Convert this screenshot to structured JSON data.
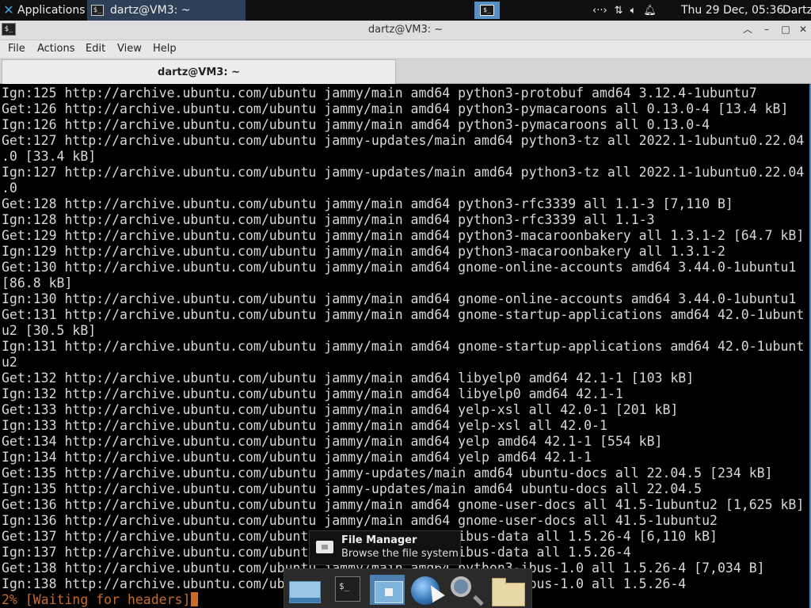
{
  "panel": {
    "applications_label": "Applications",
    "applications_icon": "xfce-mouse-icon",
    "task_terminal_label": "dartz@VM3: ~",
    "clock": "Thu 29 Dec, 05:36",
    "user": "Dartz",
    "tray_icons": [
      "network-icon",
      "transfer-icon",
      "volume-icon",
      "notification-bell-icon"
    ]
  },
  "window": {
    "title": "dartz@VM3: ~",
    "menu": [
      "File",
      "Actions",
      "Edit",
      "View",
      "Help"
    ],
    "tab_label": "dartz@VM3: ~"
  },
  "terminal": {
    "lines": [
      "Ign:125 http://archive.ubuntu.com/ubuntu jammy/main amd64 python3-protobuf amd64 3.12.4-1ubuntu7",
      "Get:126 http://archive.ubuntu.com/ubuntu jammy/main amd64 python3-pymacaroons all 0.13.0-4 [13.4 kB]",
      "Ign:126 http://archive.ubuntu.com/ubuntu jammy/main amd64 python3-pymacaroons all 0.13.0-4",
      "Get:127 http://archive.ubuntu.com/ubuntu jammy-updates/main amd64 python3-tz all 2022.1-1ubuntu0.22.04",
      ".0 [33.4 kB]",
      "Ign:127 http://archive.ubuntu.com/ubuntu jammy-updates/main amd64 python3-tz all 2022.1-1ubuntu0.22.04",
      ".0",
      "Get:128 http://archive.ubuntu.com/ubuntu jammy/main amd64 python3-rfc3339 all 1.1-3 [7,110 B]",
      "Ign:128 http://archive.ubuntu.com/ubuntu jammy/main amd64 python3-rfc3339 all 1.1-3",
      "Get:129 http://archive.ubuntu.com/ubuntu jammy/main amd64 python3-macaroonbakery all 1.3.1-2 [64.7 kB]",
      "Ign:129 http://archive.ubuntu.com/ubuntu jammy/main amd64 python3-macaroonbakery all 1.3.1-2",
      "Get:130 http://archive.ubuntu.com/ubuntu jammy/main amd64 gnome-online-accounts amd64 3.44.0-1ubuntu1",
      "[86.8 kB]",
      "Ign:130 http://archive.ubuntu.com/ubuntu jammy/main amd64 gnome-online-accounts amd64 3.44.0-1ubuntu1",
      "Get:131 http://archive.ubuntu.com/ubuntu jammy/main amd64 gnome-startup-applications amd64 42.0-1ubunt",
      "u2 [30.5 kB]",
      "Ign:131 http://archive.ubuntu.com/ubuntu jammy/main amd64 gnome-startup-applications amd64 42.0-1ubunt",
      "u2",
      "Get:132 http://archive.ubuntu.com/ubuntu jammy/main amd64 libyelp0 amd64 42.1-1 [103 kB]",
      "Ign:132 http://archive.ubuntu.com/ubuntu jammy/main amd64 libyelp0 amd64 42.1-1",
      "Get:133 http://archive.ubuntu.com/ubuntu jammy/main amd64 yelp-xsl all 42.0-1 [201 kB]",
      "Ign:133 http://archive.ubuntu.com/ubuntu jammy/main amd64 yelp-xsl all 42.0-1",
      "Get:134 http://archive.ubuntu.com/ubuntu jammy/main amd64 yelp amd64 42.1-1 [554 kB]",
      "Ign:134 http://archive.ubuntu.com/ubuntu jammy/main amd64 yelp amd64 42.1-1",
      "Get:135 http://archive.ubuntu.com/ubuntu jammy-updates/main amd64 ubuntu-docs all 22.04.5 [234 kB]",
      "Ign:135 http://archive.ubuntu.com/ubuntu jammy-updates/main amd64 ubuntu-docs all 22.04.5",
      "Get:136 http://archive.ubuntu.com/ubuntu jammy/main amd64 gnome-user-docs all 41.5-1ubuntu2 [1,625 kB]",
      "Ign:136 http://archive.ubuntu.com/ubuntu jammy/main amd64 gnome-user-docs all 41.5-1ubuntu2",
      "Get:137 http://archive.ubuntu.com/ubuntu jammy/main amd64 ibus-data all 1.5.26-4 [6,110 kB]",
      "Ign:137 http://archive.ubuntu.com/ubuntu jammy/main amd64 ibus-data all 1.5.26-4",
      "Get:138 http://archive.ubuntu.com/ubuntu jammy/main amd64 python3-ibus-1.0 all 1.5.26-4 [7,034 B]",
      "Ign:138 http://archive.ubuntu.com/ubuntu jammy/main amd64 python3-ibus-1.0 all 1.5.26-4"
    ],
    "progress_line": "2% [Waiting for headers]"
  },
  "tooltip": {
    "title": "File Manager",
    "description": "Browse the file system"
  },
  "dock": {
    "items": [
      "show-desktop-icon",
      "terminal-icon",
      "home-folder-icon",
      "web-browser-icon",
      "search-icon",
      "folder-icon"
    ],
    "active_item": "home-folder-icon"
  },
  "colors": {
    "terminal_bg": "#000000",
    "terminal_fg": "#d8d8d8",
    "progress_fg": "#c96a28",
    "panel_bg": "#101010",
    "accent": "#4a8ac2"
  }
}
